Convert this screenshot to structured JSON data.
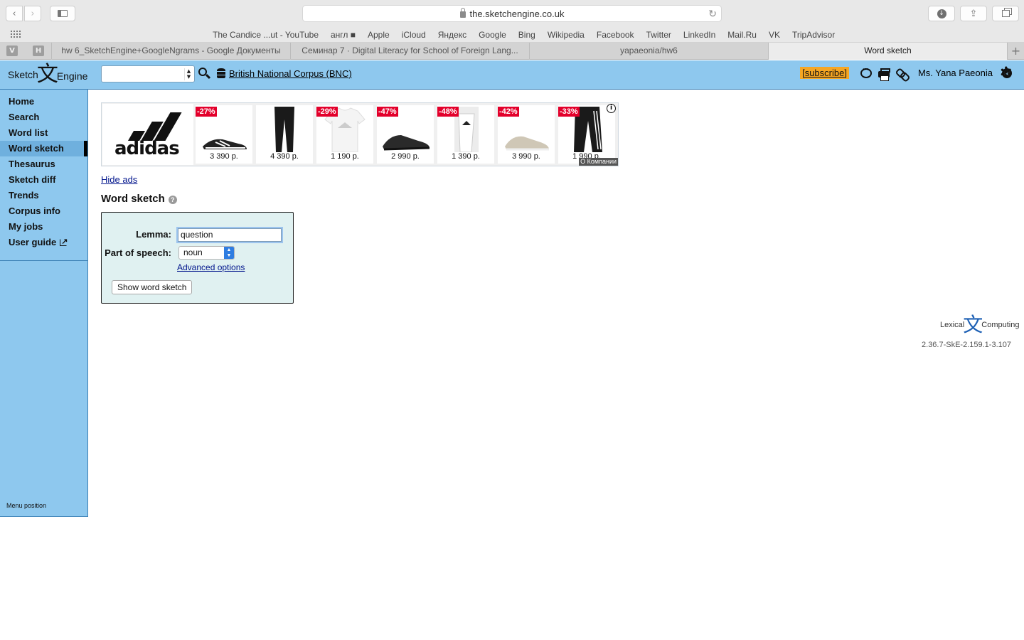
{
  "browser": {
    "url": "the.sketchengine.co.uk",
    "favorites": [
      "The Candice ...ut - YouTube",
      "англ ■",
      "Apple",
      "iCloud",
      "Яндекс",
      "Google",
      "Bing",
      "Wikipedia",
      "Facebook",
      "Twitter",
      "LinkedIn",
      "Mail.Ru",
      "VK",
      "TripAdvisor"
    ],
    "pinned": [
      "V",
      "H"
    ],
    "tabs": [
      {
        "label": "hw 6_SketchEngine+GoogleNgrams - Google Документы"
      },
      {
        "label": "Семинар 7 · Digital Literacy for School of Foreign Lang..."
      },
      {
        "label": "yapaeonia/hw6"
      },
      {
        "label": "Word sketch"
      }
    ]
  },
  "header": {
    "logo_left": "Sketch",
    "logo_glyph": "文",
    "logo_right": "Engine",
    "corpus": "British National Corpus (BNC)",
    "subscribe": "[subscribe]",
    "user": "Ms. Yana Paeonia"
  },
  "sidebar": {
    "items": [
      {
        "label": "Home"
      },
      {
        "label": "Search"
      },
      {
        "label": "Word list"
      },
      {
        "label": "Word sketch",
        "active": true
      },
      {
        "label": "Thesaurus"
      },
      {
        "label": "Sketch diff"
      },
      {
        "label": "Trends"
      },
      {
        "label": "Corpus info"
      },
      {
        "label": "My jobs"
      },
      {
        "label": "User guide"
      }
    ],
    "menu_position": "Menu position"
  },
  "ad": {
    "brand": "adidas",
    "products": [
      {
        "discount": "-27%",
        "price": "3 390 р."
      },
      {
        "discount": "",
        "price": "4 390 р."
      },
      {
        "discount": "-29%",
        "price": "1 190 р."
      },
      {
        "discount": "-47%",
        "price": "2 990 р."
      },
      {
        "discount": "-48%",
        "price": "1 390 р."
      },
      {
        "discount": "-42%",
        "price": "3 990 р."
      },
      {
        "discount": "-33%",
        "price": "1 990 р."
      }
    ],
    "about": "О Компании",
    "hide": "Hide ads"
  },
  "page": {
    "title": "Word sketch",
    "help": "?"
  },
  "form": {
    "lemma_label": "Lemma:",
    "lemma_value": "question",
    "pos_label": "Part of speech:",
    "pos_value": "noun",
    "advanced": "Advanced options",
    "submit": "Show word sketch"
  },
  "footer": {
    "lexical": "Lexical",
    "glyph": "文",
    "computing": "Computing",
    "version": "2.36.7-SkE-2.159.1-3.107"
  }
}
